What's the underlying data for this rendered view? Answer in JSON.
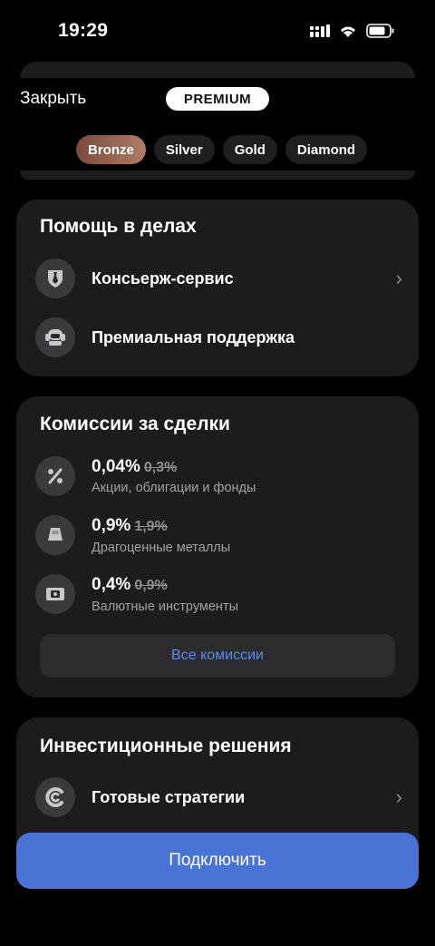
{
  "status": {
    "time": "19:29"
  },
  "header": {
    "close_label": "Закрыть",
    "badge": "PREMIUM",
    "tiers": [
      "Bronze",
      "Silver",
      "Gold",
      "Diamond"
    ],
    "active_tier": "Bronze"
  },
  "help": {
    "title": "Помощь в делах",
    "items": [
      {
        "label": "Консьерж-сервис",
        "icon": "tie-icon"
      },
      {
        "label": "Премиальная поддержка",
        "icon": "support-icon"
      }
    ]
  },
  "fees": {
    "title": "Комиссии за сделки",
    "items": [
      {
        "value": "0,04%",
        "old": "0,3%",
        "desc": "Акции, облигации и фонды",
        "icon": "percent-icon"
      },
      {
        "value": "0,9%",
        "old": "1,9%",
        "desc": "Драгоценные металлы",
        "icon": "gold-bar-icon"
      },
      {
        "value": "0,4%",
        "old": "0,9%",
        "desc": "Валютные инструменты",
        "icon": "banknote-icon"
      }
    ],
    "all_label": "Все комиссии"
  },
  "invest": {
    "title": "Инвестиционные решения",
    "items": [
      {
        "label": "Готовые стратегии",
        "icon": "strategy-icon"
      }
    ]
  },
  "cta": {
    "label": "Подключить"
  },
  "colors": {
    "accent": "#4a73d6",
    "link": "#5b8bf0",
    "card": "#1c1c1e"
  }
}
